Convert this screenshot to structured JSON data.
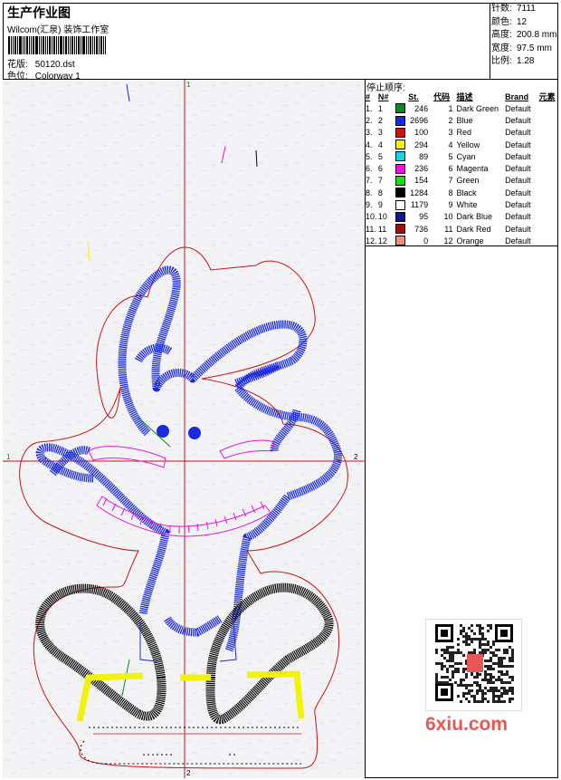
{
  "header": {
    "title": "生产作业图",
    "company": "Wilcom(汇泉) 装饰工作室",
    "design_label": "花版:",
    "design_value": "50120.dst",
    "colorway_label": "色位:",
    "colorway_value": "Colorway 1"
  },
  "stats": [
    {
      "key": "针数:",
      "value": "7111"
    },
    {
      "key": "颜色:",
      "value": "12"
    },
    {
      "key": "高度:",
      "value": "200.8 mm"
    },
    {
      "key": "宽度:",
      "value": "97.5 mm"
    },
    {
      "key": "比例:",
      "value": "1.28"
    }
  ],
  "stop_sequence": {
    "label": "停止顺序:",
    "columns": [
      "#",
      "N#",
      "St.",
      "代码",
      "描述",
      "Brand",
      "元素"
    ],
    "rows": [
      {
        "n": "1.",
        "needle": "1",
        "st": "246",
        "code": "1",
        "desc": "Dark Green",
        "brand": "Default",
        "color": "#0b8a1e"
      },
      {
        "n": "2.",
        "needle": "2",
        "st": "2696",
        "code": "2",
        "desc": "Blue",
        "brand": "Default",
        "color": "#1a2ae0"
      },
      {
        "n": "3.",
        "needle": "3",
        "st": "100",
        "code": "3",
        "desc": "Red",
        "brand": "Default",
        "color": "#c81414"
      },
      {
        "n": "4.",
        "needle": "4",
        "st": "294",
        "code": "4",
        "desc": "Yellow",
        "brand": "Default",
        "color": "#f2f20a"
      },
      {
        "n": "5.",
        "needle": "5",
        "st": "89",
        "code": "5",
        "desc": "Cyan",
        "brand": "Default",
        "color": "#14d6e6"
      },
      {
        "n": "6.",
        "needle": "6",
        "st": "236",
        "code": "6",
        "desc": "Magenta",
        "brand": "Default",
        "color": "#e614d6"
      },
      {
        "n": "7.",
        "needle": "7",
        "st": "154",
        "code": "7",
        "desc": "Green",
        "brand": "Default",
        "color": "#14e014"
      },
      {
        "n": "8.",
        "needle": "8",
        "st": "1284",
        "code": "8",
        "desc": "Black",
        "brand": "Default",
        "color": "#000000"
      },
      {
        "n": "9.",
        "needle": "9",
        "st": "1179",
        "code": "9",
        "desc": "White",
        "brand": "Default",
        "color": "#ffffff"
      },
      {
        "n": "10.",
        "needle": "10",
        "st": "95",
        "code": "10",
        "desc": "Dark Blue",
        "brand": "Default",
        "color": "#0a1a8c"
      },
      {
        "n": "11.",
        "needle": "11",
        "st": "736",
        "code": "11",
        "desc": "Dark Red",
        "brand": "Default",
        "color": "#a01010"
      },
      {
        "n": "12.",
        "needle": "12",
        "st": "0",
        "code": "12",
        "desc": "Orange",
        "brand": "Default",
        "color": "#f0907a"
      }
    ]
  },
  "canvas": {
    "axis_top": "1",
    "axis_bottom": "2",
    "axis_left": "1",
    "axis_right": "2"
  },
  "watermark": "6xiu.com",
  "colors": {
    "outline": "#c81414",
    "blue": "#1a2ae0",
    "black": "#000000",
    "yellow": "#f2f20a",
    "magenta": "#e614d6",
    "green": "#0b8a1e"
  }
}
